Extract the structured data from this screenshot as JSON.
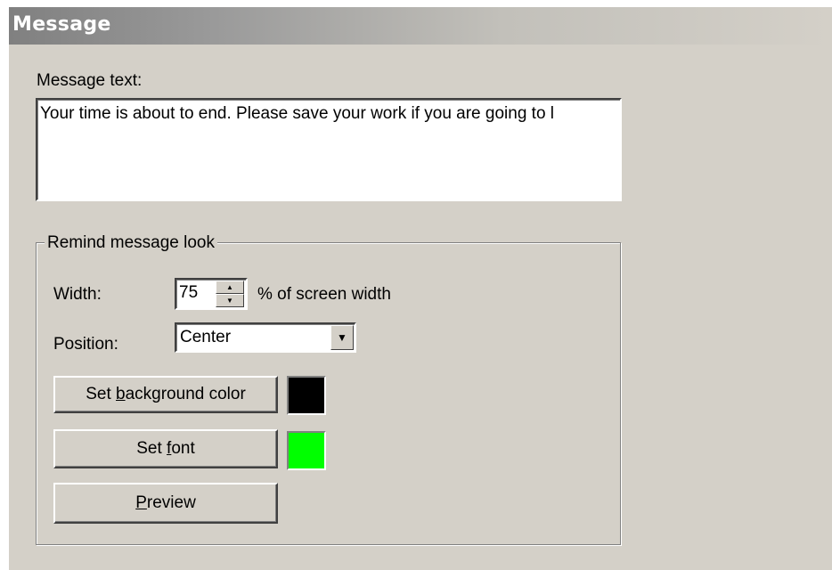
{
  "title": "Message",
  "message": {
    "label": "Message text:",
    "text": "Your time is about to end. Please save your work if you are going to l"
  },
  "group": {
    "legend": "Remind message look",
    "width": {
      "label": "Width:",
      "value": "75",
      "suffix": "% of screen width"
    },
    "position": {
      "label": "Position:",
      "selected": "Center"
    },
    "buttons": {
      "background": {
        "pre": "Set ",
        "accel": "b",
        "post": "ackground color"
      },
      "font": {
        "pre": "Set ",
        "accel": "f",
        "post": "ont"
      },
      "preview": {
        "pre": "",
        "accel": "P",
        "post": "review"
      }
    },
    "swatches": {
      "background_color": "#000000",
      "font_color": "#00ff00"
    }
  },
  "icons": {
    "spin_up": "▲",
    "spin_down": "▼",
    "dropdown": "▼"
  }
}
